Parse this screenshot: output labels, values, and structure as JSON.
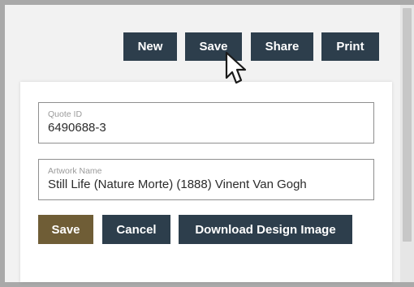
{
  "toolbar": {
    "new_label": "New",
    "save_label": "Save",
    "share_label": "Share",
    "print_label": "Print"
  },
  "form": {
    "quote_id": {
      "label": "Quote ID",
      "value": "6490688-3"
    },
    "artwork_name": {
      "label": "Artwork Name",
      "value": "Still Life (Nature Morte) (1888) Vinent Van Gogh"
    },
    "save_label": "Save",
    "cancel_label": "Cancel",
    "download_label": "Download Design Image"
  },
  "colors": {
    "toolbar_button": "#2d3e4c",
    "save_button": "#6f5d36",
    "frame_border": "#a9a9a9"
  },
  "icons": {
    "cursor": "mouse-pointer-icon"
  }
}
